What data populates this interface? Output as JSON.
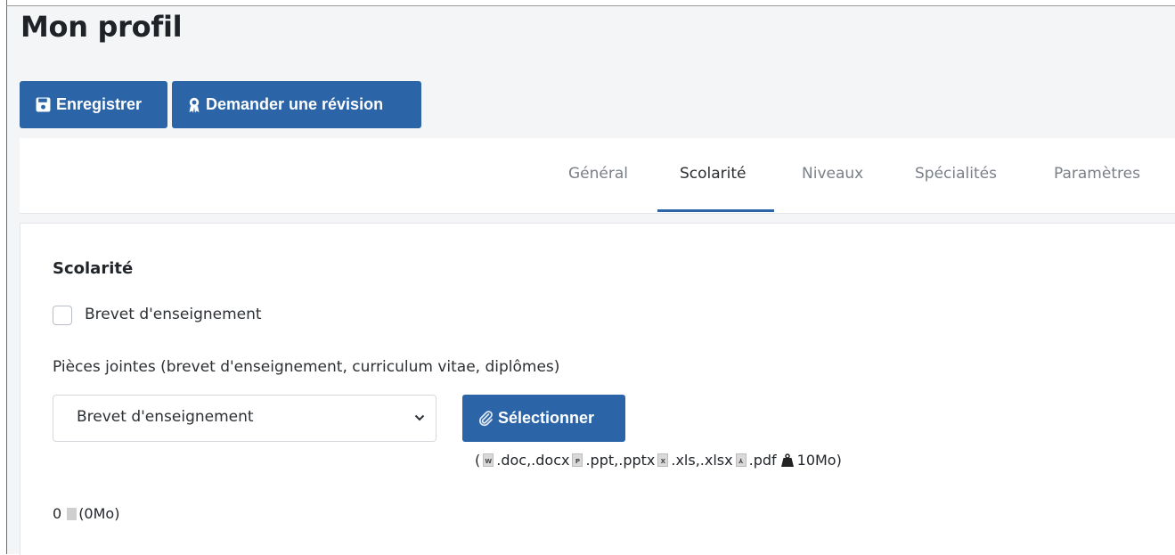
{
  "page": {
    "title": "Mon profil"
  },
  "toolbar": {
    "save_label": "Enregistrer",
    "review_label": "Demander une révision"
  },
  "tabs": [
    {
      "label": "Général",
      "active": false
    },
    {
      "label": "Scolarité",
      "active": true
    },
    {
      "label": "Niveaux",
      "active": false
    },
    {
      "label": "Spécialités",
      "active": false
    },
    {
      "label": "Paramètres",
      "active": false
    }
  ],
  "section": {
    "title": "Scolarité",
    "checkbox_label": "Brevet d'enseignement",
    "checkbox_checked": false,
    "attachments_label": "Pièces jointes (brevet d'enseignement, curriculum vitae, diplômes)",
    "select_value": "Brevet d'enseignement",
    "select_button_label": "Sélectionner",
    "formats": {
      "open": "(",
      "doc": ".doc,.docx",
      "ppt": ".ppt,.pptx",
      "xls": ".xls,.xlsx",
      "pdf": ".pdf",
      "max_size": "10Mo)"
    },
    "counter": {
      "count": "0",
      "size": "(0Mo)"
    }
  },
  "colors": {
    "primary": "#2b65a8",
    "page_background": "#f4f5f7"
  },
  "icons": {
    "save": "floppy-disk-icon",
    "review": "award-ribbon-icon",
    "attach": "paperclip-icon",
    "select_caret": "chevron-down-icon",
    "weight": "weight-icon",
    "file": "file-icon"
  }
}
